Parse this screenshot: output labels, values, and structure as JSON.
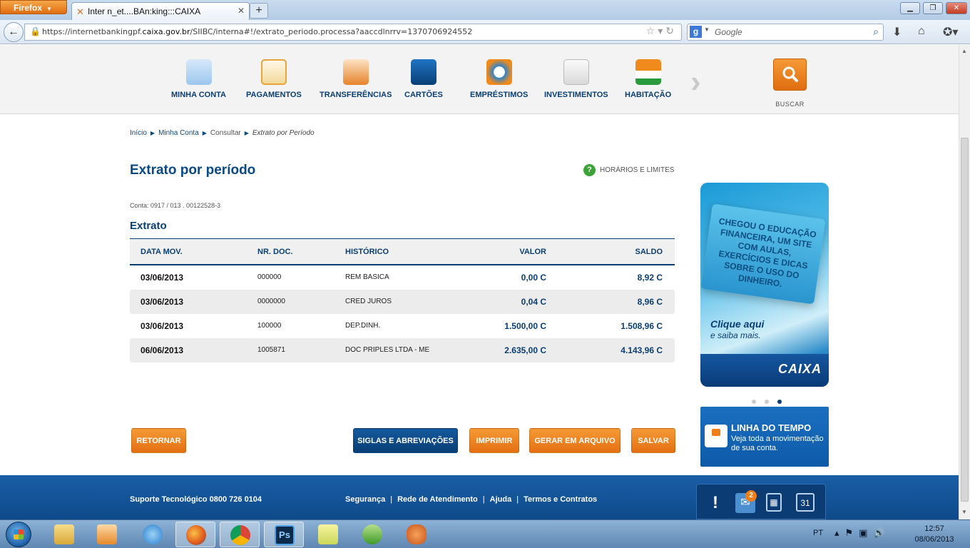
{
  "browser": {
    "app_button": "Firefox",
    "tab_title": "Inter n_et....BAn:king:::CAIXA",
    "url_prefix": "https://internetbankingpf.",
    "url_domain": "caixa.gov.br",
    "url_path": "/SIIBC/interna#!/extrato_periodo.processa?aaccdlnrrv=1370706924552",
    "search_placeholder": "Google"
  },
  "menu": {
    "items": [
      {
        "label": "MINHA CONTA",
        "color": "#2f7cc4"
      },
      {
        "label": "PAGAMENTOS",
        "color": "#e8a33a"
      },
      {
        "label": "TRANSFERÊNCIAS",
        "color": "#e7832b"
      },
      {
        "label": "CARTÕES",
        "color": "#0d5aa8"
      },
      {
        "label": "EMPRÉSTIMOS",
        "color": "#2d83cd"
      },
      {
        "label": "INVESTIMENTOS",
        "color": "#d9d9d9"
      },
      {
        "label": "HABITAÇÃO",
        "color": "#f08a1c"
      }
    ],
    "search_label": "BUSCAR"
  },
  "breadcrumb": {
    "items": [
      "Início",
      "Minha Conta",
      "Consultar",
      "Extrato por Período"
    ]
  },
  "page": {
    "title": "Extrato por período",
    "hours_link": "HORÁRIOS E LIMITES",
    "account": "Conta: 0917 / 013 . 00122528-3",
    "subtitle": "Extrato"
  },
  "table": {
    "headers": [
      "DATA MOV.",
      "NR. DOC.",
      "HISTÓRICO",
      "VALOR",
      "SALDO"
    ],
    "rows": [
      [
        "03/06/2013",
        "000000",
        "REM BASICA",
        "0,00 C",
        "8,92 C"
      ],
      [
        "03/06/2013",
        "0000000",
        "CRED JUROS",
        "0,04 C",
        "8,96 C"
      ],
      [
        "03/06/2013",
        "100000",
        "DEP.DINH.",
        "1.500,00 C",
        "1.508,96 C"
      ],
      [
        "06/06/2013",
        "1005871",
        "DOC PRIPLES LTDA - ME",
        "2.635,00 C",
        "4.143,96 C"
      ]
    ]
  },
  "buttons": {
    "back": "RETORNAR",
    "abbrev": "SIGLAS E ABREVIAÇÕES",
    "print": "IMPRIMIR",
    "file": "GERAR EM ARQUIVO",
    "save": "SALVAR"
  },
  "ad": {
    "headline": "Chegou o Educação Financeira, um site com aulas, exercícios e dicas sobre o uso do dinheiro.",
    "cta": "Clique aqui",
    "cta2": "e saiba mais.",
    "logo": "CAIXA"
  },
  "timeline": {
    "title": "LINHA DO TEMPO",
    "text": "Veja toda a movimentação de sua conta."
  },
  "footer": {
    "support": "Suporte Tecnológico 0800 726 0104",
    "links": [
      "Segurança",
      "Rede de Atendimento",
      "Ajuda",
      "Termos e Contratos"
    ],
    "mail_badge": "2"
  },
  "taskbar": {
    "lang": "PT",
    "time": "12:57",
    "date": "08/06/2013"
  }
}
